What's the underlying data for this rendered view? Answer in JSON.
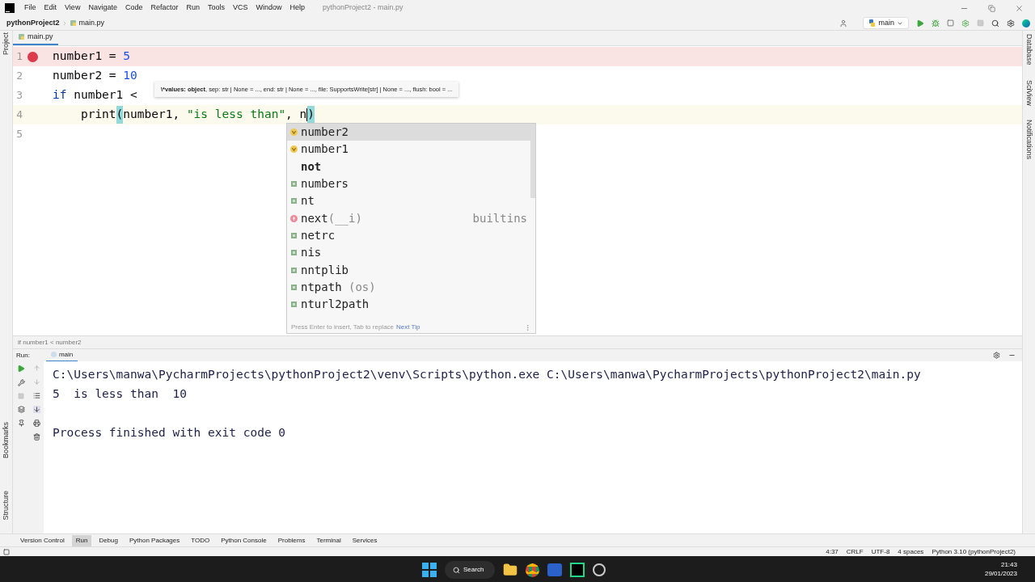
{
  "menu_bar": {
    "items": [
      "File",
      "Edit",
      "View",
      "Navigate",
      "Code",
      "Refactor",
      "Run",
      "Tools",
      "VCS",
      "Window",
      "Help"
    ],
    "title": "pythonProject2 - main.py"
  },
  "nav_bar": {
    "project": "pythonProject2",
    "file": "main.py",
    "run_config": "main"
  },
  "editor_tabs": [
    {
      "label": "main.py",
      "selected": true
    }
  ],
  "left_strip": [
    "Project",
    "Bookmarks",
    "Structure"
  ],
  "right_strip": [
    "Database",
    "SciView",
    "Notifications"
  ],
  "code_lines": [
    {
      "number": "1",
      "breakpoint": true,
      "current": false,
      "tokens": [
        {
          "kind": "plain",
          "text": "number1 = "
        },
        {
          "kind": "number",
          "text": "5"
        }
      ]
    },
    {
      "number": "2",
      "breakpoint": false,
      "current": false,
      "tokens": [
        {
          "kind": "plain",
          "text": "number2 = "
        },
        {
          "kind": "number",
          "text": "10"
        }
      ]
    },
    {
      "number": "3",
      "breakpoint": false,
      "current": false,
      "tokens": [
        {
          "kind": "keyword",
          "text": "if"
        },
        {
          "kind": "plain",
          "text": " number1 < "
        }
      ]
    },
    {
      "number": "4",
      "breakpoint": false,
      "current": true,
      "tokens": [
        {
          "kind": "plain",
          "text": "    print"
        },
        {
          "kind": "match",
          "text": "("
        },
        {
          "kind": "plain",
          "text": "number1, "
        },
        {
          "kind": "string",
          "text": "\"is less than\""
        },
        {
          "kind": "plain",
          "text": ", n"
        },
        {
          "kind": "caret"
        },
        {
          "kind": "match",
          "text": ")"
        }
      ]
    },
    {
      "number": "5",
      "breakpoint": false,
      "current": false
    }
  ],
  "param_hint": "**\\*values: object**, sep: str | None = ..., end: str | None = ..., file: SupportsWrite[str] | None = ..., flush: bool = ...",
  "completion": {
    "items": [
      {
        "kind": "variable",
        "text": "number2",
        "bold": false,
        "selected": true
      },
      {
        "kind": "variable",
        "text": "number1",
        "bold": false,
        "selected": false
      },
      {
        "kind": "none",
        "text": "not",
        "bold": true,
        "selected": false
      },
      {
        "kind": "module",
        "text": "numbers",
        "bold": false,
        "selected": false
      },
      {
        "kind": "module",
        "text": "nt",
        "bold": false,
        "selected": false
      },
      {
        "kind": "function",
        "text": "next",
        "tail": "(__i)",
        "type": "builtins",
        "bold": false,
        "selected": false
      },
      {
        "kind": "module",
        "text": "netrc",
        "bold": false,
        "selected": false
      },
      {
        "kind": "module",
        "text": "nis",
        "bold": false,
        "selected": false
      },
      {
        "kind": "module",
        "text": "nntplib",
        "bold": false,
        "selected": false
      },
      {
        "kind": "module",
        "text": "ntpath",
        "tail": " (os)",
        "bold": false,
        "selected": false
      },
      {
        "kind": "module",
        "text": "nturl2path",
        "bold": false,
        "selected": false
      }
    ],
    "footer": "Press Enter to insert, Tab to replace",
    "footer_link": "Next Tip"
  },
  "breadcrumb": "if number1 < number2",
  "run_panel": {
    "label": "Run:",
    "tab": "main",
    "output": [
      "C:\\Users\\manwa\\PycharmProjects\\pythonProject2\\venv\\Scripts\\python.exe C:\\Users\\manwa\\PycharmProjects\\pythonProject2\\main.py",
      "5  is less than  10"
    ],
    "exit_message": "Process finished with exit code 0"
  },
  "tool_windows": [
    {
      "label": "Version Control",
      "selected": false
    },
    {
      "label": "Run",
      "selected": true
    },
    {
      "label": "Debug",
      "selected": false
    },
    {
      "label": "Python Packages",
      "selected": false
    },
    {
      "label": "TODO",
      "selected": false
    },
    {
      "label": "Python Console",
      "selected": false
    },
    {
      "label": "Problems",
      "selected": false
    },
    {
      "label": "Terminal",
      "selected": false
    },
    {
      "label": "Services",
      "selected": false
    }
  ],
  "status_bar": [
    "4:37",
    "CRLF",
    "UTF-8",
    "4 spaces",
    "Python 3.10 (pythonProject2)"
  ],
  "taskbar": {
    "search": "Search",
    "time": "21:43",
    "date": "29/01/2023"
  }
}
